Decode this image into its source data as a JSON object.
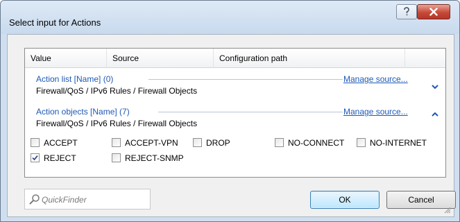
{
  "dialog": {
    "title": "Select input for Actions"
  },
  "columns": [
    "Value",
    "Source",
    "Configuration path",
    ""
  ],
  "groups": [
    {
      "title": "Action list [Name] (0)",
      "path": "Firewall/QoS / IPv6 Rules / Firewall Objects",
      "manage_label": "Manage source...",
      "expanded": false
    },
    {
      "title": "Action objects [Name] (7)",
      "path": "Firewall/QoS / IPv6 Rules / Firewall Objects",
      "manage_label": "Manage source...",
      "expanded": true
    }
  ],
  "options": [
    {
      "label": "ACCEPT",
      "checked": false
    },
    {
      "label": "ACCEPT-VPN",
      "checked": false
    },
    {
      "label": "DROP",
      "checked": false
    },
    {
      "label": "NO-CONNECT",
      "checked": false
    },
    {
      "label": "NO-INTERNET",
      "checked": false
    },
    {
      "label": "REJECT",
      "checked": true
    },
    {
      "label": "REJECT-SNMP",
      "checked": false
    }
  ],
  "quickfinder": {
    "placeholder": "QuickFinder"
  },
  "buttons": {
    "ok": "OK",
    "cancel": "Cancel"
  },
  "colors": {
    "link": "#1e58b6",
    "title_bar": "#c9daee",
    "close_button": "#c74a38"
  },
  "icons": {
    "help": "question-icon",
    "close": "close-icon",
    "search": "search-icon",
    "collapse": "chevron-up-icon",
    "expand": "chevron-down-icon"
  }
}
